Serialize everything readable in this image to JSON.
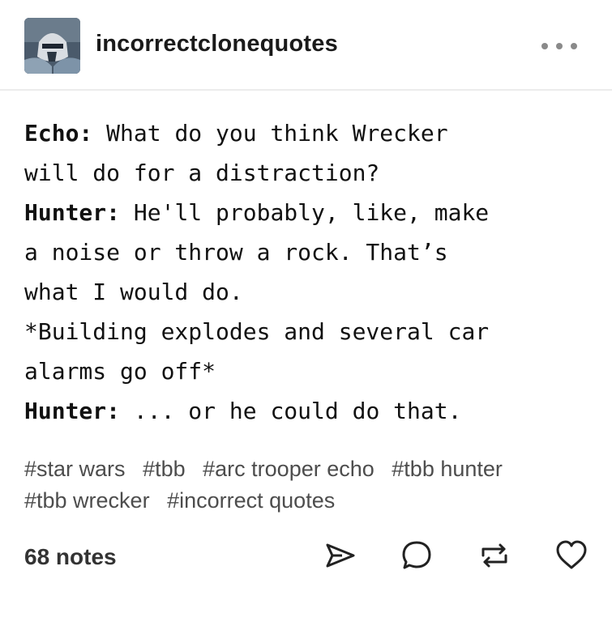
{
  "post": {
    "username": "incorrectclonequotes",
    "avatar_icon": "clone-trooper-avatar-icon",
    "menu_icon": "more-options-icon"
  },
  "quote": [
    [
      {
        "text": "Echo:",
        "bold": true
      },
      {
        "text": " What do you think Wrecker",
        "bold": false
      }
    ],
    [
      {
        "text": "will do for a distraction?",
        "bold": false
      }
    ],
    [
      {
        "text": "Hunter:",
        "bold": true
      },
      {
        "text": " He'll probably, like, make",
        "bold": false
      }
    ],
    [
      {
        "text": "a noise or throw a rock. That’s",
        "bold": false
      }
    ],
    [
      {
        "text": "what I would do.",
        "bold": false
      }
    ],
    [
      {
        "text": "*Building explodes and several car",
        "bold": false
      }
    ],
    [
      {
        "text": "alarms go off*",
        "bold": false
      }
    ],
    [
      {
        "text": "Hunter:",
        "bold": true
      },
      {
        "text": " ... or he could do that.",
        "bold": false
      }
    ]
  ],
  "tags": [
    "#star wars",
    "#tbb",
    "#arc trooper echo",
    "#tbb hunter",
    "#tbb wrecker",
    "#incorrect quotes"
  ],
  "footer": {
    "notes": "68 notes",
    "actions": [
      "share-icon",
      "reply-icon",
      "reblog-icon",
      "like-icon"
    ]
  },
  "colors": {
    "text": "#111111",
    "tags": "#4d4d4d",
    "divider": "#ececec",
    "icon": "#222222"
  }
}
